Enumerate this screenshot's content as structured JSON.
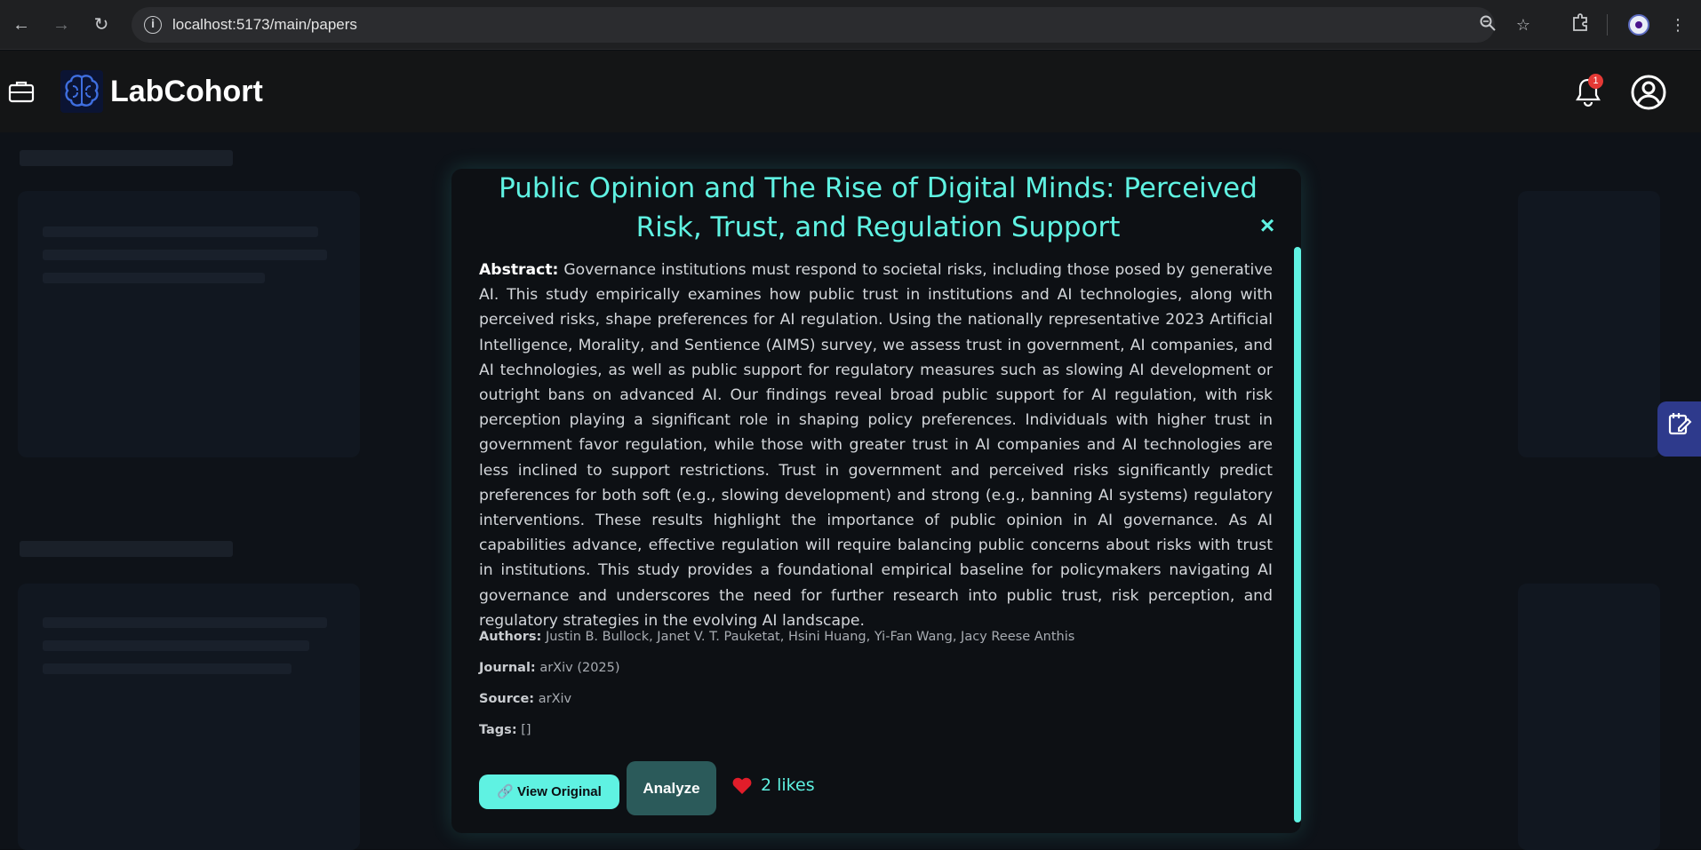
{
  "browser": {
    "url": "localhost:5173/main/papers",
    "info_glyph": "i"
  },
  "app": {
    "brand": "LabCohort",
    "notification_count": "1"
  },
  "paper": {
    "title": "Public Opinion and The Rise of Digital Minds: Perceived Risk, Trust, and Regulation Support",
    "abstract_label": "Abstract:",
    "abstract": "Governance institutions must respond to societal risks, including those posed by generative AI. This study empirically examines how public trust in institutions and AI technologies, along with perceived risks, shape preferences for AI regulation. Using the nationally representative 2023 Artificial Intelligence, Morality, and Sentience (AIMS) survey, we assess trust in government, AI companies, and AI technologies, as well as public support for regulatory measures such as slowing AI development or outright bans on advanced AI. Our findings reveal broad public support for AI regulation, with risk perception playing a significant role in shaping policy preferences. Individuals with higher trust in government favor regulation, while those with greater trust in AI companies and AI technologies are less inclined to support restrictions. Trust in government and perceived risks significantly predict preferences for both soft (e.g., slowing development) and strong (e.g., banning AI systems) regulatory interventions. These results highlight the importance of public opinion in AI governance. As AI capabilities advance, effective regulation will require balancing public concerns about risks with trust in institutions. This study provides a foundational empirical baseline for policymakers navigating AI governance and underscores the need for further research into public trust, risk perception, and regulatory strategies in the evolving AI landscape.",
    "authors_label": "Authors:",
    "authors": "Justin B. Bullock, Janet V. T. Pauketat, Hsini Huang, Yi-Fan Wang, Jacy Reese Anthis",
    "journal_label": "Journal:",
    "journal": "arXiv (2025)",
    "source_label": "Source:",
    "source": "arXiv",
    "tags_label": "Tags:",
    "tags": "[]"
  },
  "actions": {
    "view_original": "🔗 View Original",
    "analyze": "Analyze",
    "likes": "2 likes",
    "close": "×"
  },
  "colors": {
    "accent": "#5ff2e2",
    "analyze_bg": "#2b5a5a",
    "heart": "#e11d2a",
    "side_tab": "#2e3a8c"
  },
  "icons": [
    "back-icon",
    "forward-icon",
    "reload-icon",
    "site-info-icon",
    "zoom-icon",
    "star-icon",
    "extensions-icon",
    "profile-icon",
    "menu-icon",
    "briefcase-icon",
    "brain-logo-icon",
    "bell-icon",
    "user-icon",
    "close-icon",
    "heart-icon",
    "notes-icon"
  ]
}
